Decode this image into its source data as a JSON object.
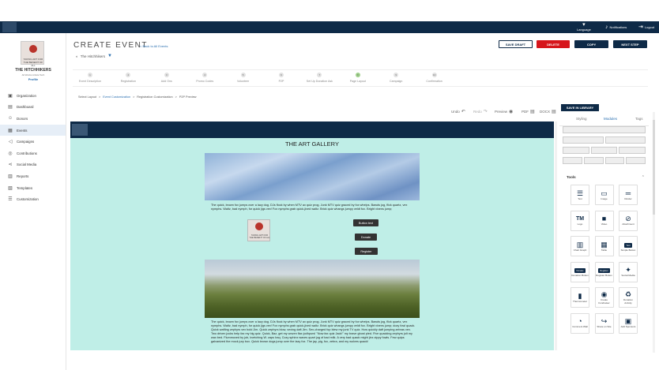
{
  "topbar": {
    "language_label": "Language",
    "notifications_label": "Notifications",
    "logout_label": "Logout"
  },
  "org": {
    "logo_text": "TAKING ART FOR THE BENEFIT OF ALL",
    "name": "THE HITCHHIKERS",
    "subtitle": "All Works Artists Tech",
    "profile_label": "Profile"
  },
  "sidebar": {
    "items": [
      {
        "label": "Organization",
        "icon": "building-icon",
        "glyph": "▣"
      },
      {
        "label": "Dashboard",
        "icon": "dashboard-icon",
        "glyph": "▤"
      },
      {
        "label": "Donors",
        "icon": "donors-icon",
        "glyph": "☺"
      },
      {
        "label": "Events",
        "icon": "calendar-icon",
        "glyph": "▦",
        "active": true
      },
      {
        "label": "Campaigns",
        "icon": "megaphone-icon",
        "glyph": "◁"
      },
      {
        "label": "Contributions",
        "icon": "coins-icon",
        "glyph": "◎"
      },
      {
        "label": "Social Media",
        "icon": "share-icon",
        "glyph": "⋖"
      },
      {
        "label": "Reports",
        "icon": "chart-icon",
        "glyph": "▥"
      },
      {
        "label": "Templates",
        "icon": "template-icon",
        "glyph": "▧"
      },
      {
        "label": "Customization",
        "icon": "sliders-icon",
        "glyph": "☰"
      }
    ]
  },
  "header": {
    "title": "CREATE EVENT",
    "back_link": "< Back to All Events",
    "event_name": "The Hitchhikers"
  },
  "actions": {
    "save_draft": "SAVE DRAFT",
    "delete": "DELETE",
    "copy": "COPY",
    "next_step": "NEXT STEP"
  },
  "steps": [
    {
      "num": "1",
      "label": "Event Description"
    },
    {
      "num": "2",
      "label": "Registration"
    },
    {
      "num": "3",
      "label": "Add Ons"
    },
    {
      "num": "4",
      "label": "Promo Codes"
    },
    {
      "num": "5",
      "label": "Volunteer"
    },
    {
      "num": "6",
      "label": "P2P"
    },
    {
      "num": "7",
      "label": "Set Up Donation Ask"
    },
    {
      "num": "8",
      "label": "Page Layout",
      "current": true
    },
    {
      "num": "9",
      "label": "Campaign"
    },
    {
      "num": "10",
      "label": "Confirmation"
    }
  ],
  "breadcrumb": {
    "item1": "Select Layout",
    "item2": "Event Customization",
    "item3": "Registration Customization",
    "item4": "P2P Preview",
    "sep": ">"
  },
  "editor_toolbar": {
    "undo": "Undo",
    "redo": "Redo",
    "preview": "Preview",
    "pdf": "PDF",
    "docx": "DOCX"
  },
  "save_in_library": "SAVE IN LIBRARY",
  "canvas": {
    "title": "THE ART GALLERY",
    "para1": "The quick, brown fox jumps over a lazy dog. DJs flock by when MTV ax quiz prog. Junk MTV quiz graced by fox whelps. Bawds jog, flick quartz, vex nymphs. Waltz, bad nymph, for quick jigs vex! Fox nymphs grab quick-jived waltz. Brick quiz whangs jumpy veldt fox. Bright vixens jump;",
    "thumb_text": "TAKING ART FOR THE BENEFIT OF ALL",
    "btn_text": "Button text",
    "btn_donate": "Donate",
    "btn_register": "Register",
    "para2": "The quick, brown fox jumps over a lazy dog. DJs flock by when MTV ax quiz prog. Junk MTV quiz graced by fox whelps. Bawds jog, flick quartz, vex nymphs. Waltz, bad nymph, for quick jigs vex! Fox nymphs grab quick-jived waltz. Brick quiz whangs jumpy veldt fox. Bright vixens jump; dozy fowl quack. Quick wafting zephyrs vex bold Jim. Quick zephyrs blow, vexing daft Jim. Sex-charged fop blew my junk TV quiz. How quickly daft jumping zebras vex. Two driven jocks help fax my big quiz. Quick, Baz, get my woven flax jodhpurs! \"Now fax quiz Jack!\" my brave ghost pled. Five quacking zephyrs jolt my wax bed. Flummoxed by job, kvetching W. zaps Iraq. Cozy sphinx waves quart jug of bad milk. A very bad quack might jinx zippy fowls. Few quips galvanized the mock jury box. Quick brown dogs jump over the lazy fox. The jay, pig, fox, zebra, and my wolves quack!"
  },
  "rpanel": {
    "tab_styling": "Styling",
    "tab_modules": "Modules",
    "tab_tags": "Tags",
    "tools_header": "Tools",
    "tools": [
      {
        "label": "Text",
        "icon": "text-align-icon",
        "glyph": "☰",
        "kind": "glyph"
      },
      {
        "label": "Image",
        "icon": "image-icon",
        "glyph": "▭",
        "kind": "glyph"
      },
      {
        "label": "Divider",
        "icon": "divider-icon",
        "glyph": "═",
        "kind": "glyph"
      },
      {
        "label": "Logo",
        "icon": "logo-tm-icon",
        "glyph": "TM",
        "kind": "txt"
      },
      {
        "label": "Video",
        "icon": "video-icon",
        "glyph": "■",
        "kind": "glyph"
      },
      {
        "label": "Attachment",
        "icon": "paperclip-icon",
        "glyph": "⊘",
        "kind": "glyph"
      },
      {
        "label": "Chart Graph",
        "icon": "bar-chart-icon",
        "glyph": "▥",
        "kind": "glyph"
      },
      {
        "label": "Table",
        "icon": "table-icon",
        "glyph": "▦",
        "kind": "glyph"
      },
      {
        "label": "Simple Button",
        "icon": "button-icon",
        "glyph": "Text",
        "kind": "pill"
      },
      {
        "label": "Donation Button",
        "icon": "donate-button-icon",
        "glyph": "Donate",
        "kind": "pill"
      },
      {
        "label": "Register Button",
        "icon": "register-button-icon",
        "glyph": "Register",
        "kind": "pill"
      },
      {
        "label": "Social Media",
        "icon": "social-icon",
        "glyph": "✦",
        "kind": "glyph"
      },
      {
        "label": "Thermometer",
        "icon": "thermometer-icon",
        "glyph": "▮",
        "kind": "glyph"
      },
      {
        "label": "Create Fundraiser",
        "icon": "magnifier-icon",
        "glyph": "◉",
        "kind": "glyph"
      },
      {
        "label": "Donation Activity",
        "icon": "activity-icon",
        "glyph": "♻",
        "kind": "glyph"
      },
      {
        "label": "Comment Wall",
        "icon": "comment-icon",
        "glyph": "◔",
        "kind": "glyph"
      },
      {
        "label": "Share on Site",
        "icon": "share-arrow-icon",
        "glyph": "↪",
        "kind": "glyph"
      },
      {
        "label": "Add Sponsors",
        "icon": "sponsor-icon",
        "glyph": "▣",
        "kind": "glyph"
      }
    ]
  },
  "colors": {
    "navy": "#0e2a47",
    "delete_red": "#d6151b",
    "canvas_bg": "#bfeee7",
    "link_blue": "#2a6fb0",
    "step_current": "#9fd18b"
  }
}
